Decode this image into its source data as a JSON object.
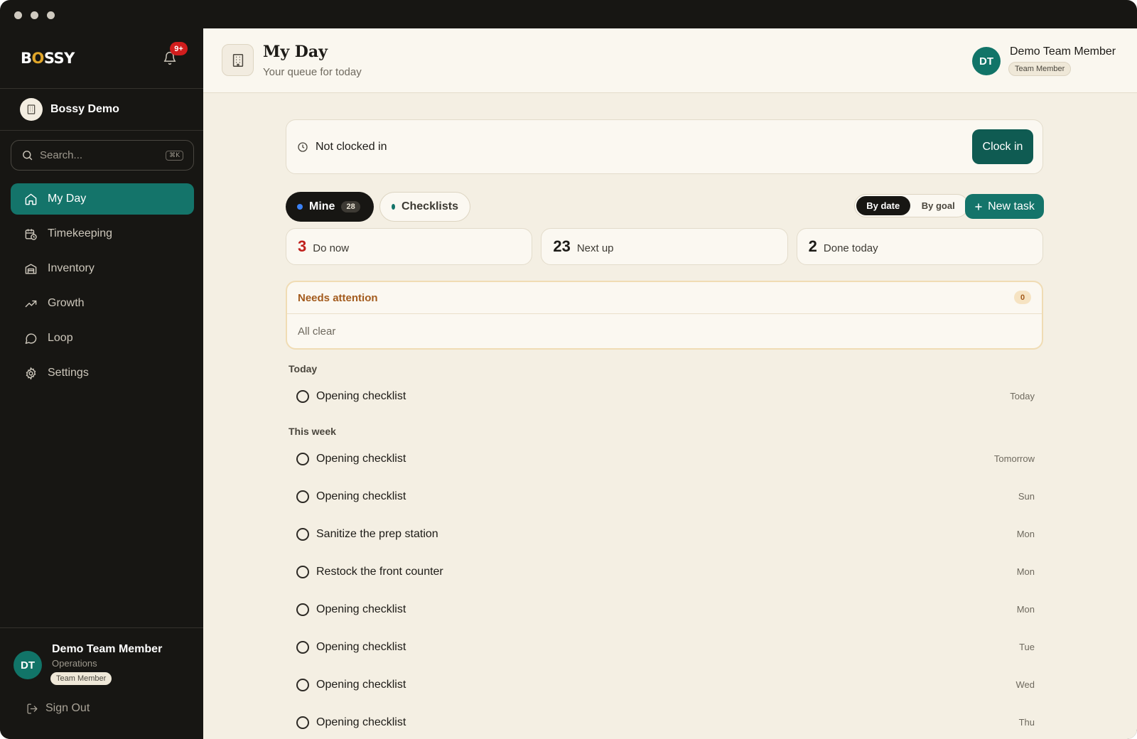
{
  "brand": {
    "logo_text_1": "B",
    "logo_text_2": "O",
    "logo_text_3": "SSY",
    "notifications_badge": "9+"
  },
  "org": {
    "name": "Bossy Demo"
  },
  "search": {
    "placeholder": "Search...",
    "shortcut": "⌘K"
  },
  "nav": [
    {
      "label": "My Day",
      "icon": "home-icon",
      "active": true
    },
    {
      "label": "Timekeeping",
      "icon": "calendar-clock-icon"
    },
    {
      "label": "Inventory",
      "icon": "warehouse-icon"
    },
    {
      "label": "Growth",
      "icon": "trending-up-icon"
    },
    {
      "label": "Loop",
      "icon": "message-circle-icon"
    },
    {
      "label": "Settings",
      "icon": "gear-icon"
    }
  ],
  "user": {
    "initials": "DT",
    "name": "Demo Team Member",
    "department": "Operations",
    "role": "Team Member",
    "sign_out": "Sign Out"
  },
  "header": {
    "title": "My Day",
    "subtitle": "Your queue for today"
  },
  "clock": {
    "status": "Not clocked in",
    "button": "Clock in"
  },
  "filters": {
    "mine": {
      "label": "Mine",
      "count": "28"
    },
    "checklists": {
      "label": "Checklists"
    },
    "sort": {
      "by_date": "By date",
      "by_goal": "By goal"
    },
    "new_task": "New task"
  },
  "stats": [
    {
      "value": "3",
      "label": "Do now"
    },
    {
      "value": "23",
      "label": "Next up"
    },
    {
      "value": "2",
      "label": "Done today"
    }
  ],
  "attention": {
    "title": "Needs attention",
    "count": "0",
    "empty": "All clear"
  },
  "sections": [
    {
      "label": "Today",
      "tasks": [
        {
          "title": "Opening checklist",
          "due": "Today"
        }
      ]
    },
    {
      "label": "This week",
      "tasks": [
        {
          "title": "Opening checklist",
          "due": "Tomorrow"
        },
        {
          "title": "Opening checklist",
          "due": "Sun"
        },
        {
          "title": "Sanitize the prep station",
          "due": "Mon"
        },
        {
          "title": "Restock the front counter",
          "due": "Mon"
        },
        {
          "title": "Opening checklist",
          "due": "Mon"
        },
        {
          "title": "Opening checklist",
          "due": "Tue"
        },
        {
          "title": "Opening checklist",
          "due": "Wed"
        },
        {
          "title": "Opening checklist",
          "due": "Thu"
        }
      ]
    }
  ],
  "colors": {
    "accent": "#14746a",
    "sidebar": "#171613",
    "background": "#f4efe3",
    "danger": "#c0211d",
    "warning": "#a35b1d"
  }
}
